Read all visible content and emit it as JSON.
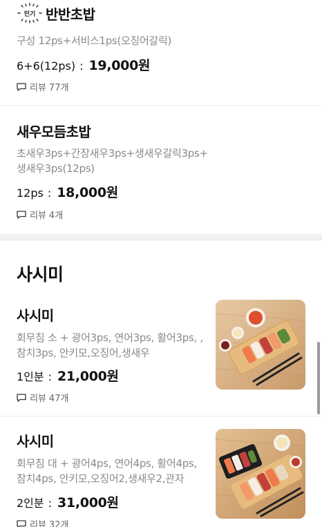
{
  "items": [
    {
      "badge": "인기",
      "title": "반반초밥",
      "desc_lines": [
        "구성 12ps+서비스1ps(오징어갈릭)"
      ],
      "price_label": "6+6(12ps)",
      "price_sep": ":",
      "price": "19,000원",
      "review_label": "리뷰",
      "review_count": "77개"
    },
    {
      "title": "새우모듬초밥",
      "desc_lines": [
        "초새우3ps+간장새우3ps+생새우갈릭3ps+",
        "생새우3ps(12ps)"
      ],
      "price_label": "12ps",
      "price_sep": ":",
      "price": "18,000원",
      "review_label": "리뷰",
      "review_count": "4개"
    }
  ],
  "section": {
    "title": "사시미"
  },
  "sashimi_items": [
    {
      "title": "사시미",
      "desc_lines": [
        "회무침 소 + 광어3ps, 연어3ps, 활어3ps, ,",
        "참치3ps, 안키모,오징어,생새우"
      ],
      "price_label": "1인분",
      "price_sep": ":",
      "price": "21,000원",
      "review_label": "리뷰",
      "review_count": "47개",
      "image": "sashimi-small-platter"
    },
    {
      "title": "사시미",
      "desc_lines": [
        "회무침 대 + 광어4ps, 연어4ps, 활어4ps,",
        "참치4ps, 안키모,오징어2,생새우2,관자"
      ],
      "price_label": "2인분",
      "price_sep": ":",
      "price": "31,000원",
      "review_label": "리뷰",
      "review_count": "32개",
      "image": "sashimi-large-platter"
    }
  ],
  "icons": {
    "review": "speech-bubble-icon",
    "badge": "popular-badge-icon"
  },
  "colors": {
    "text": "#111111",
    "muted": "#8a8a8a",
    "divider": "#ececec",
    "section_bg": "#f2f2f2"
  }
}
